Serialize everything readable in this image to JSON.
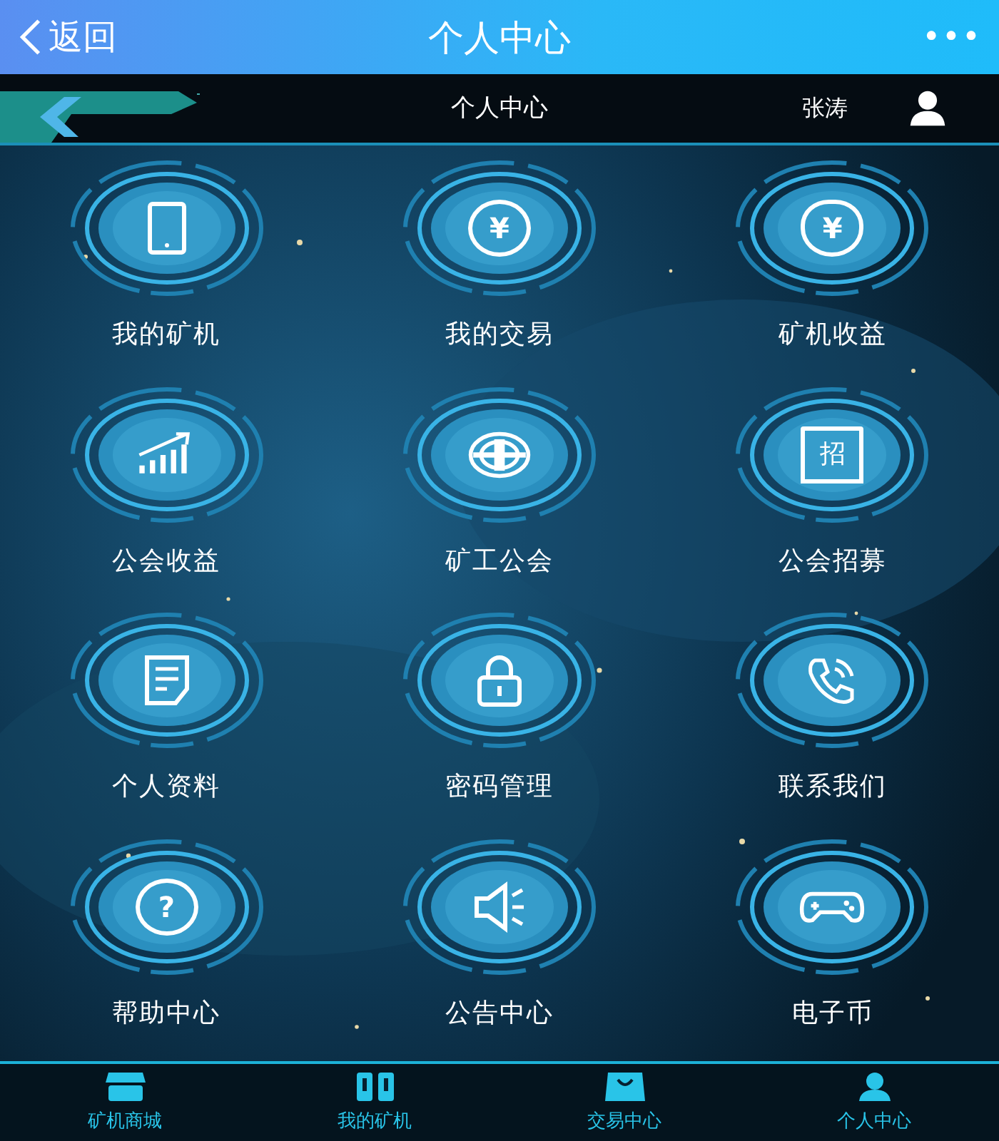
{
  "header": {
    "back": "返回",
    "title": "个人中心",
    "more": "•••"
  },
  "subheader": {
    "title": "个人中心",
    "user": "张涛"
  },
  "items": [
    {
      "label": "我的矿机"
    },
    {
      "label": "我的交易",
      "glyph": "¥"
    },
    {
      "label": "矿机收益",
      "glyph": "¥"
    },
    {
      "label": "公会收益"
    },
    {
      "label": "矿工公会"
    },
    {
      "label": "公会招募",
      "glyph": "招"
    },
    {
      "label": "个人资料"
    },
    {
      "label": "密码管理"
    },
    {
      "label": "联系我们"
    },
    {
      "label": "帮助中心",
      "glyph": "?"
    },
    {
      "label": "公告中心"
    },
    {
      "label": "电子币"
    }
  ],
  "tabbar": [
    {
      "label": "矿机商城"
    },
    {
      "label": "我的矿机"
    },
    {
      "label": "交易中心"
    },
    {
      "label": "个人中心"
    }
  ]
}
